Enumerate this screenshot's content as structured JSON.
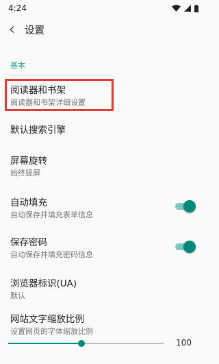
{
  "status_bar": {
    "time": "4:24"
  },
  "toolbar": {
    "title": "设置"
  },
  "section": {
    "header": "基本"
  },
  "prefs": [
    {
      "title": "阅读器和书架",
      "summary": "阅读器和书架详细设置"
    },
    {
      "title": "默认搜索引擎"
    },
    {
      "title": "屏幕旋转",
      "summary": "始终竖屏"
    },
    {
      "title": "自动填充",
      "summary": "自动保存并填充表单信息",
      "switch_on": true
    },
    {
      "title": "保存密码",
      "summary": "自动保存并填充密码信息",
      "switch_on": true
    },
    {
      "title": "浏览器标识(UA)",
      "summary": "默认"
    },
    {
      "title": "网站文字缩放比例",
      "summary": "设置网页的字体缩放比例"
    }
  ],
  "slider": {
    "value_label": "100",
    "position_fraction": 0.47
  },
  "colors": {
    "accent": "#00897b",
    "highlight": "#e53935"
  }
}
